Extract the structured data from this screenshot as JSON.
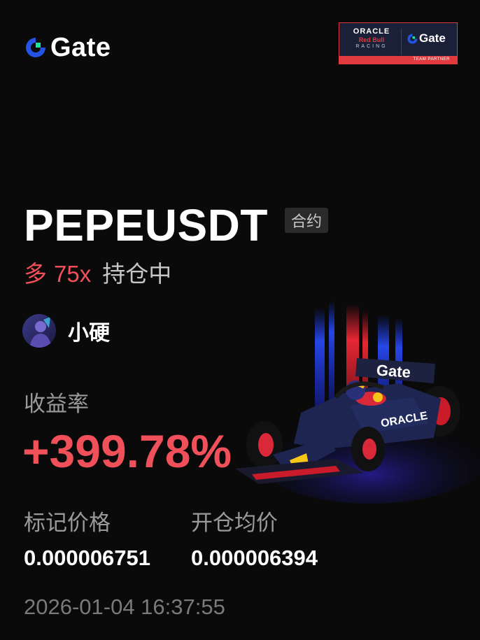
{
  "brand": {
    "logo_text": "Gate",
    "accent_color": "#2354e6",
    "accent_green": "#17e6a1"
  },
  "partner_badge": {
    "oracle": "ORACLE",
    "red_bull": "Red Bull",
    "racing": "RACING",
    "gate": "Gate",
    "footer": "TEAM PARTNER"
  },
  "position": {
    "pair": "PEPEUSDT",
    "tag": "合约",
    "direction": "多",
    "leverage": "75x",
    "status": "持仓中"
  },
  "user": {
    "name": "小硬",
    "avatar_icon": "user-avatar"
  },
  "roi": {
    "label": "收益率",
    "value": "+399.78%"
  },
  "prices": {
    "mark_label": "标记价格",
    "mark_value": "0.000006751",
    "entry_label": "开仓均价",
    "entry_value": "0.000006394"
  },
  "timestamp": "2026-01-04 16:37:55",
  "car_art": {
    "wing_text": "Gate",
    "sidepod_text": "ORACLE"
  },
  "colors": {
    "profit_red": "#f0505a",
    "muted_text": "#9a9a9a"
  }
}
